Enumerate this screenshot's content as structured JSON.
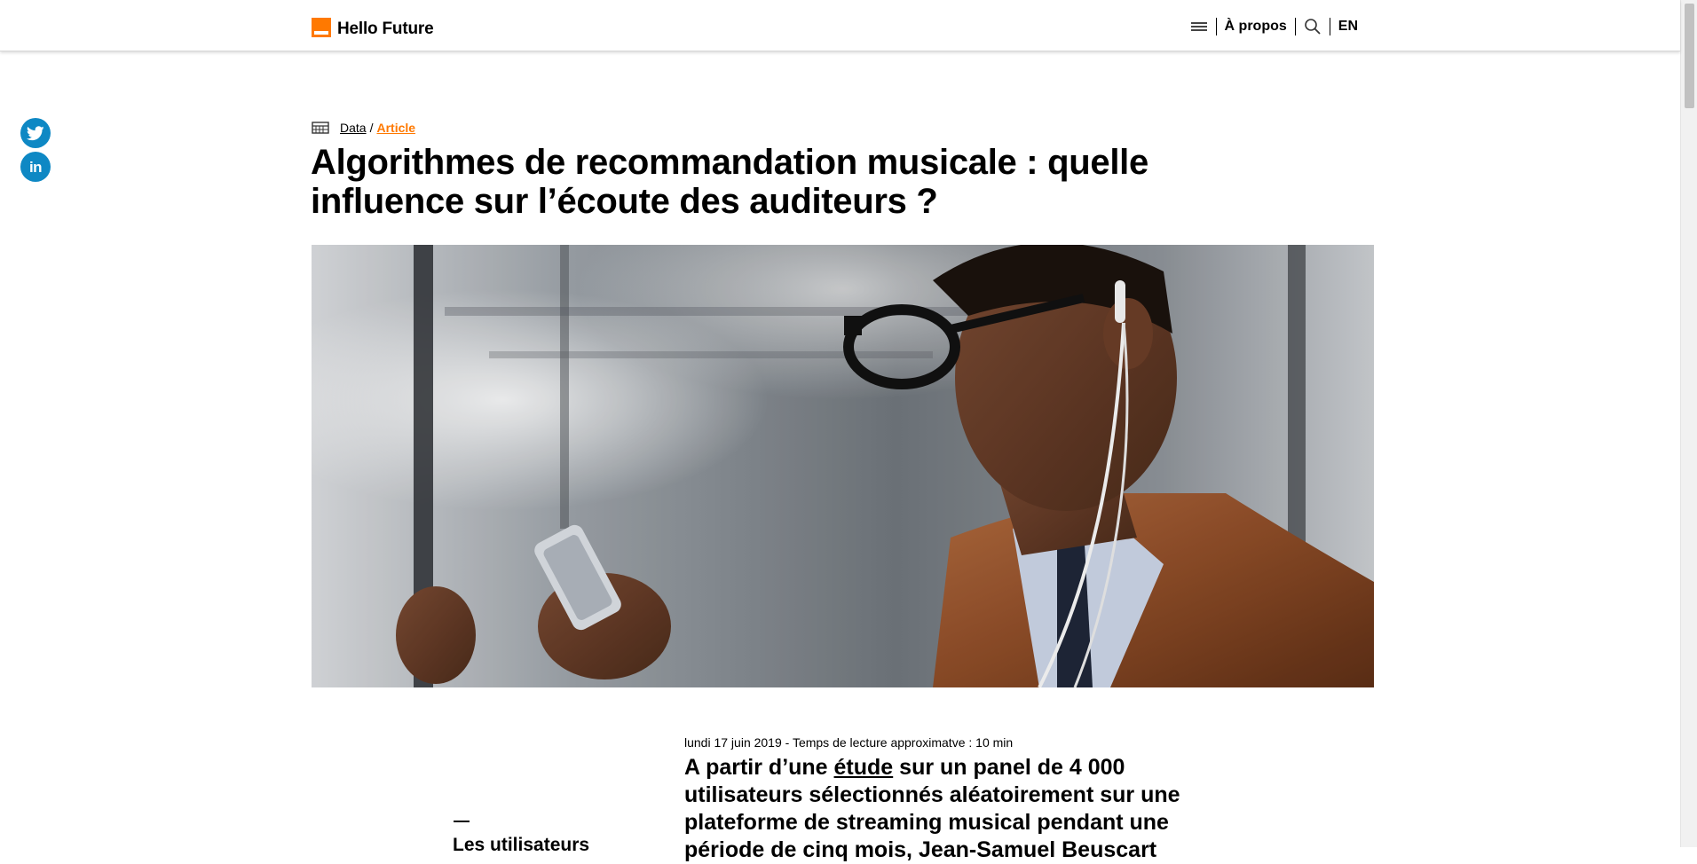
{
  "header": {
    "brand_name": "Hello Future",
    "menu_icon": "hamburger-menu-icon",
    "about_label": "À propos",
    "search_icon": "search-icon",
    "lang_label": "EN",
    "brand_color": "#ff7900"
  },
  "social": {
    "twitter_icon": "twitter-icon",
    "linkedin_label": "in",
    "color": "#0e88c4"
  },
  "breadcrumb": {
    "icon": "category-icon",
    "category": "Data",
    "separator": "/",
    "current": "Article"
  },
  "article": {
    "title": "Algorithmes de recommandation musicale : quelle influence sur l’écoute des auditeurs ?",
    "meta": "lundi 17 juin 2019 - Temps de lecture approximatve : 10 min",
    "lead_before": "A partir d’une ",
    "lead_link": "étude",
    "lead_after": " sur un panel de 4 000 utilisateurs sélectionnés aléatoirement sur une plateforme de streaming musical pendant une période de cinq mois, Jean-Samuel Beuscart",
    "aside_text": "Les utilisateurs",
    "hero_description": "photo-man-headphones-smartphone-subway"
  }
}
